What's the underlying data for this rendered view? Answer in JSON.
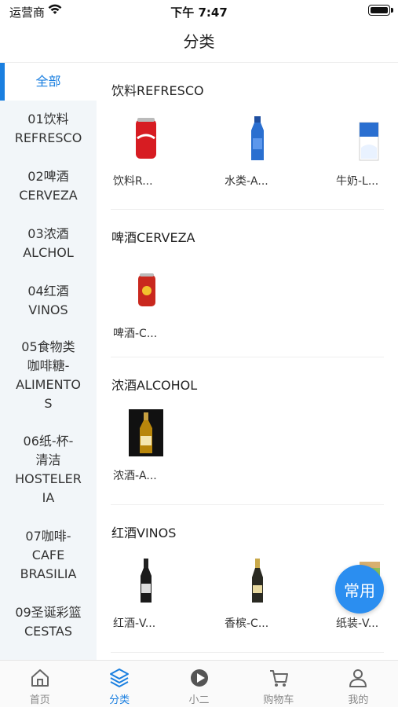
{
  "status": {
    "carrier": "运营商",
    "time": "下午 7:47"
  },
  "nav": {
    "title": "分类"
  },
  "sidebar": {
    "items": [
      {
        "label": "全部",
        "active": true
      },
      {
        "label": "01饮料\nREFRESCO"
      },
      {
        "label": "02啤酒\nCERVEZA"
      },
      {
        "label": "03浓酒\nALCHOL"
      },
      {
        "label": "04红酒\nVINOS"
      },
      {
        "label": "05食物类\n咖啡糖-\nALIMENTO\nS"
      },
      {
        "label": "06纸-杯-\n清洁\nHOSTELER\nIA"
      },
      {
        "label": "07咖啡-\nCAFE\nBRASILIA"
      },
      {
        "label": "09圣诞彩篮\nCESTAS"
      }
    ]
  },
  "sections": [
    {
      "title": "饮料REFRESCO",
      "products": [
        {
          "name": "饮料R...",
          "icon": "cola-can-icon"
        },
        {
          "name": "水类-A...",
          "icon": "water-bottle-icon"
        },
        {
          "name": "牛奶-L...",
          "icon": "milk-carton-icon"
        }
      ]
    },
    {
      "title": "啤酒CERVEZA",
      "products": [
        {
          "name": "啤酒-C...",
          "icon": "beer-can-icon"
        }
      ]
    },
    {
      "title": "浓酒ALCOHOL",
      "products": [
        {
          "name": "浓酒-A...",
          "icon": "whisky-bottle-icon"
        }
      ]
    },
    {
      "title": "红酒VINOS",
      "products": [
        {
          "name": "红酒-V...",
          "icon": "wine-bottle-icon"
        },
        {
          "name": "香槟-C...",
          "icon": "champagne-bottle-icon"
        },
        {
          "name": "纸装-V...",
          "icon": "wine-carton-icon"
        }
      ]
    }
  ],
  "float_button": {
    "label": "常用"
  },
  "tabs": [
    {
      "label": "首页",
      "icon": "home-icon"
    },
    {
      "label": "分类",
      "icon": "layers-icon",
      "active": true
    },
    {
      "label": "小二",
      "icon": "play-icon"
    },
    {
      "label": "购物车",
      "icon": "cart-icon"
    },
    {
      "label": "我的",
      "icon": "user-icon"
    }
  ],
  "colors": {
    "accent": "#1a7fe0",
    "sidebar_bg": "#f2f6f9"
  }
}
